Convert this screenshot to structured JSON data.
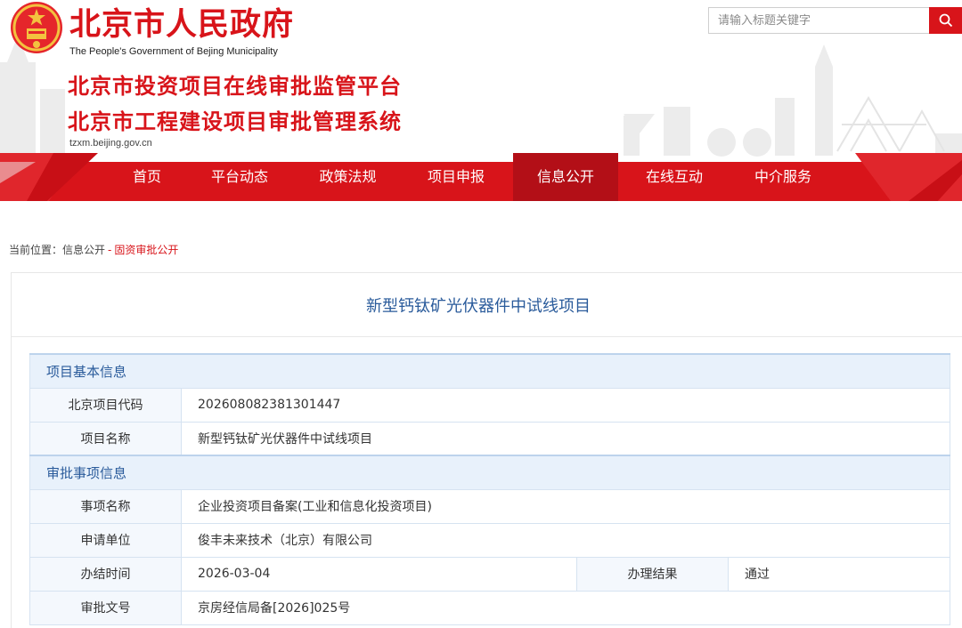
{
  "header": {
    "gov_name": "北京市人民政府",
    "gov_name_en": "The People's Government of Bejing Municipality",
    "system_title_1": "北京市投资项目在线审批监管平台",
    "system_title_2": "北京市工程建设项目审批管理系统",
    "domain": "tzxm.beijing.gov.cn",
    "colors": {
      "brand_red": "#d8141a",
      "active_nav": "#b30f17",
      "title_blue": "#2a5b9b"
    }
  },
  "search": {
    "placeholder": "请输入标题关键字",
    "button_icon": "search-icon"
  },
  "nav": {
    "items": [
      {
        "label": "首页"
      },
      {
        "label": "平台动态"
      },
      {
        "label": "政策法规"
      },
      {
        "label": "项目申报"
      },
      {
        "label": "信息公开",
        "active": true
      },
      {
        "label": "在线互动"
      },
      {
        "label": "中介服务"
      }
    ]
  },
  "breadcrumb": {
    "prefix": "当前位置：",
    "parent": "信息公开",
    "separator": "-",
    "current": "固资审批公开"
  },
  "project": {
    "title": "新型钙钛矿光伏器件中试线项目",
    "section_basic": "项目基本信息",
    "code_label": "北京项目代码",
    "code_value": "202608082381301447",
    "name_label": "项目名称",
    "name_value": "新型钙钛矿光伏器件中试线项目",
    "section_approval": "审批事项信息",
    "item_label": "事项名称",
    "item_value": "企业投资项目备案(工业和信息化投资项目)",
    "applicant_label": "申请单位",
    "applicant_value": "俊丰未来技术（北京）有限公司",
    "date_label": "办结时间",
    "date_value": "2026-03-04",
    "result_label": "办理结果",
    "result_value": "通过",
    "doc_label": "审批文号",
    "doc_value": "京房经信局备[2026]025号"
  }
}
